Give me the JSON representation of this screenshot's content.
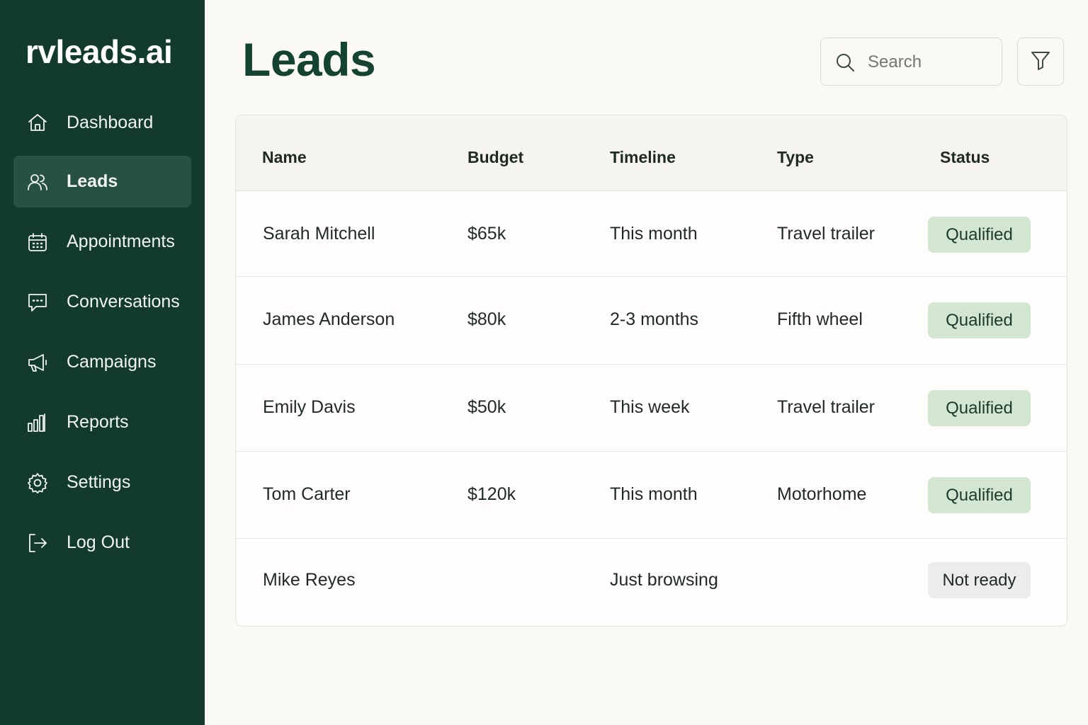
{
  "brand": "rvleads.ai",
  "sidebar": {
    "items": [
      {
        "label": "Dashboard",
        "icon": "home-icon"
      },
      {
        "label": "Leads",
        "icon": "users-icon",
        "active": true
      },
      {
        "label": "Appointments",
        "icon": "calendar-icon"
      },
      {
        "label": "Conversations",
        "icon": "chat-icon"
      },
      {
        "label": "Campaigns",
        "icon": "megaphone-icon"
      },
      {
        "label": "Reports",
        "icon": "bar-chart-icon"
      },
      {
        "label": "Settings",
        "icon": "gear-icon"
      },
      {
        "label": "Log Out",
        "icon": "logout-icon"
      }
    ]
  },
  "header": {
    "title": "Leads",
    "search_placeholder": "Search",
    "search_value": "",
    "filter_icon": "filter-icon"
  },
  "table": {
    "columns": [
      "Name",
      "Budget",
      "Timeline",
      "Type",
      "Status"
    ],
    "rows": [
      {
        "name": "Sarah Mitchell",
        "budget": "$65k",
        "timeline": "This month",
        "type": "Travel trailer",
        "status": "Qualified"
      },
      {
        "name": "James Anderson",
        "budget": "$80k",
        "timeline": "2-3 months",
        "type": "Fifth wheel",
        "status": "Qualified"
      },
      {
        "name": "Emily Davis",
        "budget": "$50k",
        "timeline": "This week",
        "type": "Travel trailer",
        "status": "Qualified"
      },
      {
        "name": "Tom Carter",
        "budget": "$120k",
        "timeline": "This month",
        "type": "Motorhome",
        "status": "Qualified"
      },
      {
        "name": "Mike Reyes",
        "budget": "",
        "timeline": "Just browsing",
        "type": "",
        "status": "Not ready"
      }
    ]
  },
  "colors": {
    "sidebar_bg": "#123b2e",
    "sidebar_active": "#275242",
    "title": "#154332",
    "badge_qualified": "#d2e6d1",
    "badge_not_ready": "#ececea",
    "page_bg": "#fbf9f5"
  }
}
